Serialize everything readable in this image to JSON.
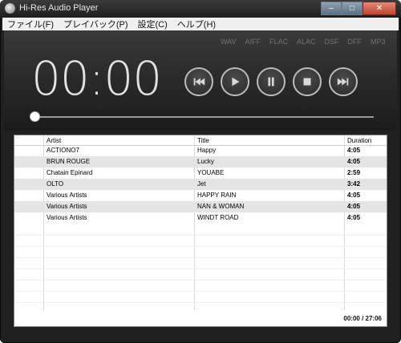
{
  "window": {
    "title": "Hi-Res Audio Player",
    "minimize": "–",
    "maximize": "□",
    "close": "✕"
  },
  "menu": [
    "ファイル(F)",
    "プレイバック(P)",
    "設定(C)",
    "ヘルプ(H)"
  ],
  "formats": [
    "WAV",
    "AIFF",
    "FLAC",
    "ALAC",
    "DSF",
    "DFF",
    "MP3"
  ],
  "player": {
    "time": "00:00",
    "seek_progress": 0
  },
  "controls": [
    "previous-icon",
    "play-icon",
    "pause-icon",
    "stop-icon",
    "next-icon"
  ],
  "table": {
    "headers": {
      "artist": "Artist",
      "title": "Title",
      "duration": "Duration"
    },
    "rows": [
      {
        "artist": "ACTIONO7",
        "title": "Happy",
        "duration": "4:05"
      },
      {
        "artist": "BRUN ROUGE",
        "title": "Lucky",
        "duration": "4:05"
      },
      {
        "artist": "Chatain Epinard",
        "title": "YOUABE",
        "duration": "2:59"
      },
      {
        "artist": "OLTO",
        "title": "Jet",
        "duration": "3:42"
      },
      {
        "artist": "Various Artists",
        "title": "HAPPY RAIN",
        "duration": "4:05"
      },
      {
        "artist": "Various Artists",
        "title": "NAN & WOMAN",
        "duration": "4:05"
      },
      {
        "artist": "Various Artists",
        "title": "WINDT ROAD",
        "duration": "4:05"
      }
    ],
    "total": "00:00 / 27:06"
  }
}
